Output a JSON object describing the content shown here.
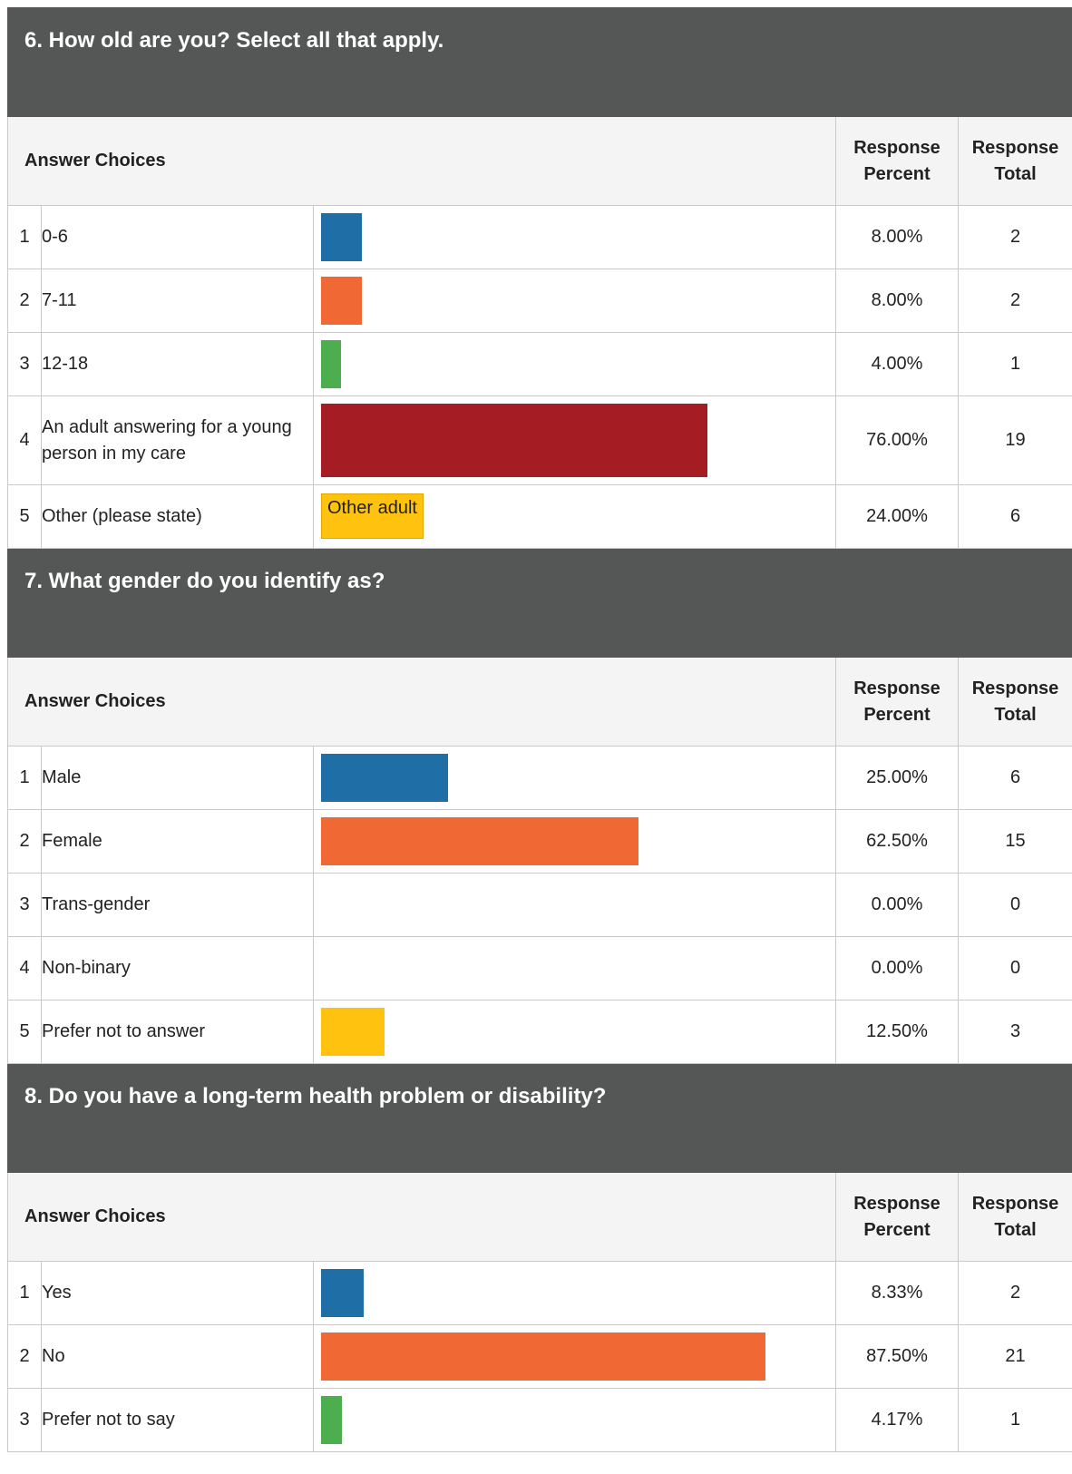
{
  "headers": {
    "answer_choices": "Answer Choices",
    "response_percent_1": "Response",
    "response_percent_2": "Percent",
    "response_total_1": "Response",
    "response_total_2": "Total"
  },
  "colors": [
    "#1f6ea6",
    "#f06833",
    "#4cae4f",
    "#a51c22",
    "#ffc20e"
  ],
  "questions": [
    {
      "title": "6. How old are you? Select all that apply.",
      "rows": [
        {
          "num": "1",
          "label": "0-6",
          "pct": "8.00%",
          "total": "2",
          "value": 8.0
        },
        {
          "num": "2",
          "label": "7-11",
          "pct": "8.00%",
          "total": "2",
          "value": 8.0
        },
        {
          "num": "3",
          "label": "12-18",
          "pct": "4.00%",
          "total": "1",
          "value": 4.0
        },
        {
          "num": "4",
          "label": "An adult answering for a young person in my care",
          "pct": "76.00%",
          "total": "19",
          "value": 76.0
        },
        {
          "num": "5",
          "label": "Other (please state)",
          "pct": "24.00%",
          "total": "6",
          "value": 24.0,
          "other_text": "Other adult"
        }
      ]
    },
    {
      "title": "7. What gender do you identify as?",
      "rows": [
        {
          "num": "1",
          "label": "Male",
          "pct": "25.00%",
          "total": "6",
          "value": 25.0
        },
        {
          "num": "2",
          "label": "Female",
          "pct": "62.50%",
          "total": "15",
          "value": 62.5
        },
        {
          "num": "3",
          "label": "Trans-gender",
          "pct": "0.00%",
          "total": "0",
          "value": 0
        },
        {
          "num": "4",
          "label": "Non-binary",
          "pct": "0.00%",
          "total": "0",
          "value": 0
        },
        {
          "num": "5",
          "label": "Prefer not to answer",
          "pct": "12.50%",
          "total": "3",
          "value": 12.5
        }
      ]
    },
    {
      "title": "8. Do you have a long-term health problem or disability?",
      "rows": [
        {
          "num": "1",
          "label": "Yes",
          "pct": "8.33%",
          "total": "2",
          "value": 8.33
        },
        {
          "num": "2",
          "label": "No",
          "pct": "87.50%",
          "total": "21",
          "value": 87.5
        },
        {
          "num": "3",
          "label": "Prefer not to say",
          "pct": "4.17%",
          "total": "1",
          "value": 4.17
        }
      ]
    }
  ]
}
